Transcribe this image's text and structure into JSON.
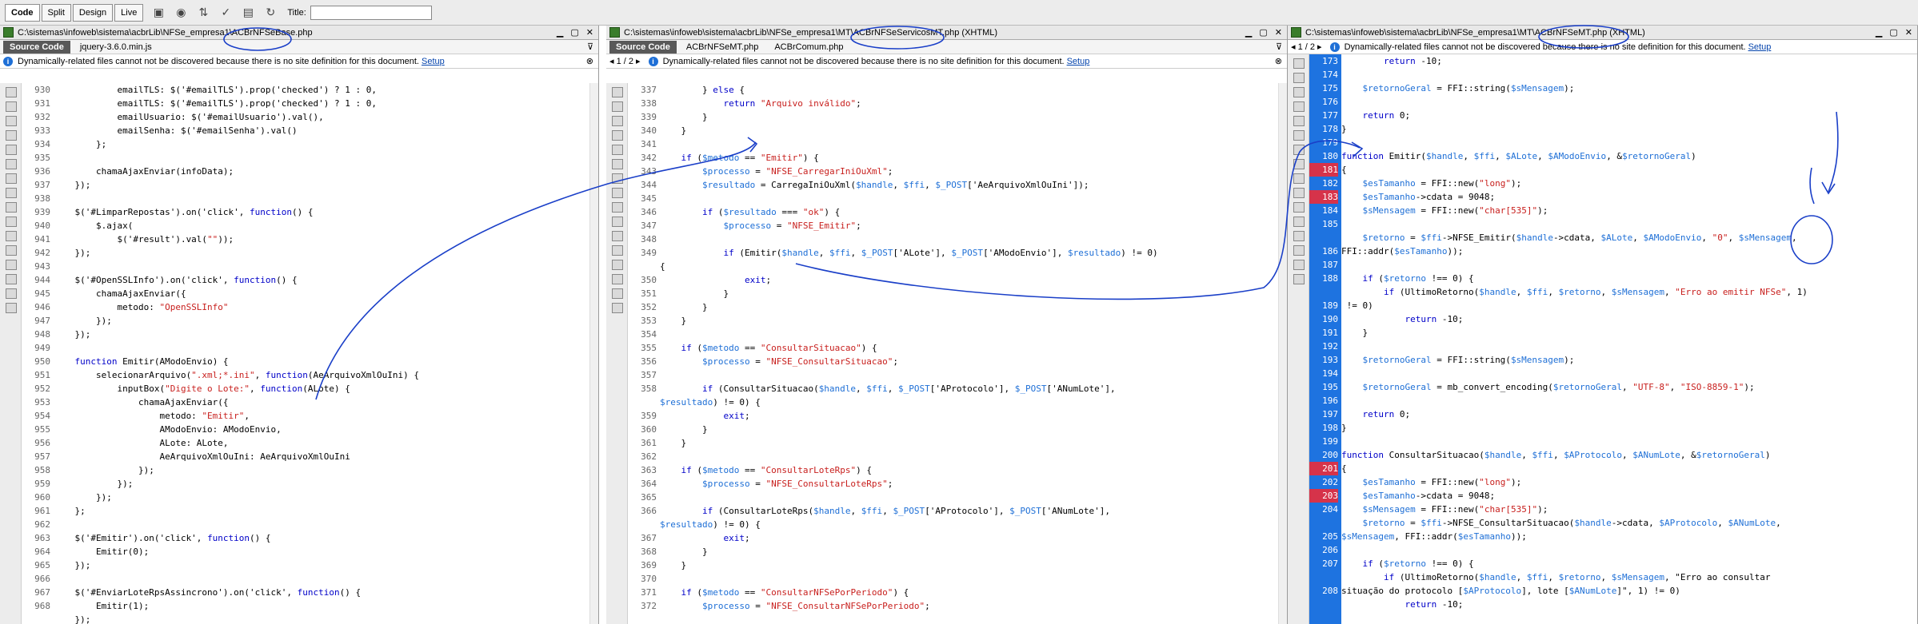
{
  "toolbar": {
    "code": "Code",
    "split": "Split",
    "design": "Design",
    "live": "Live",
    "title_label": "Title:"
  },
  "common": {
    "info_message": "Dynamically-related files cannot not be discovered because there is no site definition for this document.",
    "setup": "Setup",
    "source_code": "Source Code"
  },
  "pane1": {
    "path": "C:\\sistemas\\infoweb\\sistema\\acbrLib\\NFSe_empresa1\\ACBrNFSeBase.php",
    "tabs": [
      "Source Code",
      "jquery-3.6.0.min.js"
    ],
    "lines": [
      "930",
      "931",
      "932",
      "933",
      "934",
      "935",
      "936",
      "937",
      "938",
      "939",
      "940",
      "941",
      "942",
      "943",
      "944",
      "945",
      "946",
      "947",
      "948",
      "949",
      "950",
      "951",
      "952",
      "953",
      "954",
      "955",
      "956",
      "957",
      "958",
      "959",
      "960",
      "961",
      "962",
      "963",
      "964",
      "965",
      "966",
      "967",
      "968"
    ],
    "code": [
      "            emailTLS: $('#emailTLS').prop('checked') ? 1 : 0,",
      "            emailTLS: $('#emailTLS').prop('checked') ? 1 : 0,",
      "            emailUsuario: $('#emailUsuario').val(),",
      "            emailSenha: $('#emailSenha').val()",
      "        };",
      "",
      "        chamaAjaxEnviar(infoData);",
      "    });",
      "",
      "    $('#LimparRepostas').on('click', function() {",
      "        $.ajax(",
      "            $('#result').val(\"\"));",
      "    });",
      "",
      "    $('#OpenSSLInfo').on('click', function() {",
      "        chamaAjaxEnviar({",
      "            metodo: \"OpenSSLInfo\"",
      "        });",
      "    });",
      "",
      "    function Emitir(AModoEnvio) {",
      "        selecionarArquivo(\".xml;*.ini\", function(AeArquivoXmlOuIni) {",
      "            inputBox(\"Digite o Lote:\", function(ALote) {",
      "                chamaAjaxEnviar({",
      "                    metodo: \"Emitir\",",
      "                    AModoEnvio: AModoEnvio,",
      "                    ALote: ALote,",
      "                    AeArquivoXmlOuIni: AeArquivoXmlOuIni",
      "                });",
      "            });",
      "        });",
      "    };",
      "",
      "    $('#Emitir').on('click', function() {",
      "        Emitir(0);",
      "    });",
      "",
      "    $('#EnviarLoteRpsAssincrono').on('click', function() {",
      "        Emitir(1);",
      "    });"
    ]
  },
  "pane2": {
    "path": "C:\\sistemas\\infoweb\\sistema\\acbrLib\\NFSe_empresa1\\MT\\ACBrNFSeServicosMT.php (XHTML)",
    "tabs": [
      "Source Code",
      "ACBrNFSeMT.php",
      "ACBrComum.php"
    ],
    "pager": "1 / 2",
    "lines": [
      "337",
      "338",
      "339",
      "340",
      "341",
      "342",
      "343",
      "344",
      "345",
      "346",
      "347",
      "348",
      "349",
      "",
      "350",
      "351",
      "352",
      "353",
      "354",
      "355",
      "356",
      "357",
      "358",
      "",
      "359",
      "360",
      "361",
      "362",
      "363",
      "364",
      "365",
      "366",
      "",
      "367",
      "368",
      "369",
      "370",
      "371",
      "372"
    ],
    "code": [
      "        } else {",
      "            return \"Arquivo inválido\";",
      "        }",
      "    }",
      "",
      "    if ($metodo == \"Emitir\") {",
      "        $processo = \"NFSE_CarregarIniOuXml\";",
      "        $resultado = CarregaIniOuXml($handle, $ffi, $_POST['AeArquivoXmlOuIni']);",
      "",
      "        if ($resultado === \"ok\") {",
      "            $processo = \"NFSE_Emitir\";",
      "",
      "            if (Emitir($handle, $ffi, $_POST['ALote'], $_POST['AModoEnvio'], $resultado) != 0)",
      "{",
      "                exit;",
      "            }",
      "        }",
      "    }",
      "",
      "    if ($metodo == \"ConsultarSituacao\") {",
      "        $processo = \"NFSE_ConsultarSituacao\";",
      "",
      "        if (ConsultarSituacao($handle, $ffi, $_POST['AProtocolo'], $_POST['ANumLote'],",
      "$resultado) != 0) {",
      "            exit;",
      "        }",
      "    }",
      "",
      "    if ($metodo == \"ConsultarLoteRps\") {",
      "        $processo = \"NFSE_ConsultarLoteRps\";",
      "",
      "        if (ConsultarLoteRps($handle, $ffi, $_POST['AProtocolo'], $_POST['ANumLote'],",
      "$resultado) != 0) {",
      "            exit;",
      "        }",
      "    }",
      "",
      "    if ($metodo == \"ConsultarNFSePorPeriodo\") {",
      "        $processo = \"NFSE_ConsultarNFSePorPeriodo\";"
    ]
  },
  "pane3": {
    "path": "C:\\sistemas\\infoweb\\sistema\\acbrLib\\NFSe_empresa1\\MT\\ACBrNFSeMT.php (XHTML)",
    "pager": "1 / 2",
    "lines": [
      "173",
      "174",
      "175",
      "176",
      "177",
      "178",
      "179",
      "180",
      "181",
      "182",
      "183",
      "184",
      "185",
      "",
      "186",
      "187",
      "188",
      "",
      "189",
      "190",
      "191",
      "192",
      "193",
      "194",
      "195",
      "196",
      "197",
      "198",
      "199",
      "200",
      "201",
      "202",
      "203",
      "204",
      "",
      "205",
      "206",
      "207",
      "",
      "208"
    ],
    "code": [
      "        return -10;",
      "",
      "    $retornoGeral = FFI::string($sMensagem);",
      "",
      "    return 0;",
      "}",
      "",
      "function Emitir($handle, $ffi, $ALote, $AModoEnvio, &$retornoGeral)",
      "{",
      "    $esTamanho = FFI::new(\"long\");",
      "    $esTamanho->cdata = 9048;",
      "    $sMensagem = FFI::new(\"char[535]\");",
      "",
      "    $retorno = $ffi->NFSE_Emitir($handle->cdata, $ALote, $AModoEnvio, \"0\", $sMensagem,",
      "FFI::addr($esTamanho));",
      "",
      "    if ($retorno !== 0) {",
      "        if (UltimoRetorno($handle, $ffi, $retorno, $sMensagem, \"Erro ao emitir NFSe\", 1)",
      " != 0)",
      "            return -10;",
      "    }",
      "",
      "    $retornoGeral = FFI::string($sMensagem);",
      "",
      "    $retornoGeral = mb_convert_encoding($retornoGeral, \"UTF-8\", \"ISO-8859-1\");",
      "",
      "    return 0;",
      "}",
      "",
      "function ConsultarSituacao($handle, $ffi, $AProtocolo, $ANumLote, &$retornoGeral)",
      "{",
      "    $esTamanho = FFI::new(\"long\");",
      "    $esTamanho->cdata = 9048;",
      "    $sMensagem = FFI::new(\"char[535]\");",
      "    $retorno = $ffi->NFSE_ConsultarSituacao($handle->cdata, $AProtocolo, $ANumLote,",
      "$sMensagem, FFI::addr($esTamanho));",
      "",
      "    if ($retorno !== 0) {",
      "        if (UltimoRetorno($handle, $ffi, $retorno, $sMensagem, \"Erro ao consultar",
      "situação do protocolo [$AProtocolo], lote [$ANumLote]\", 1) != 0)",
      "            return -10;"
    ]
  }
}
